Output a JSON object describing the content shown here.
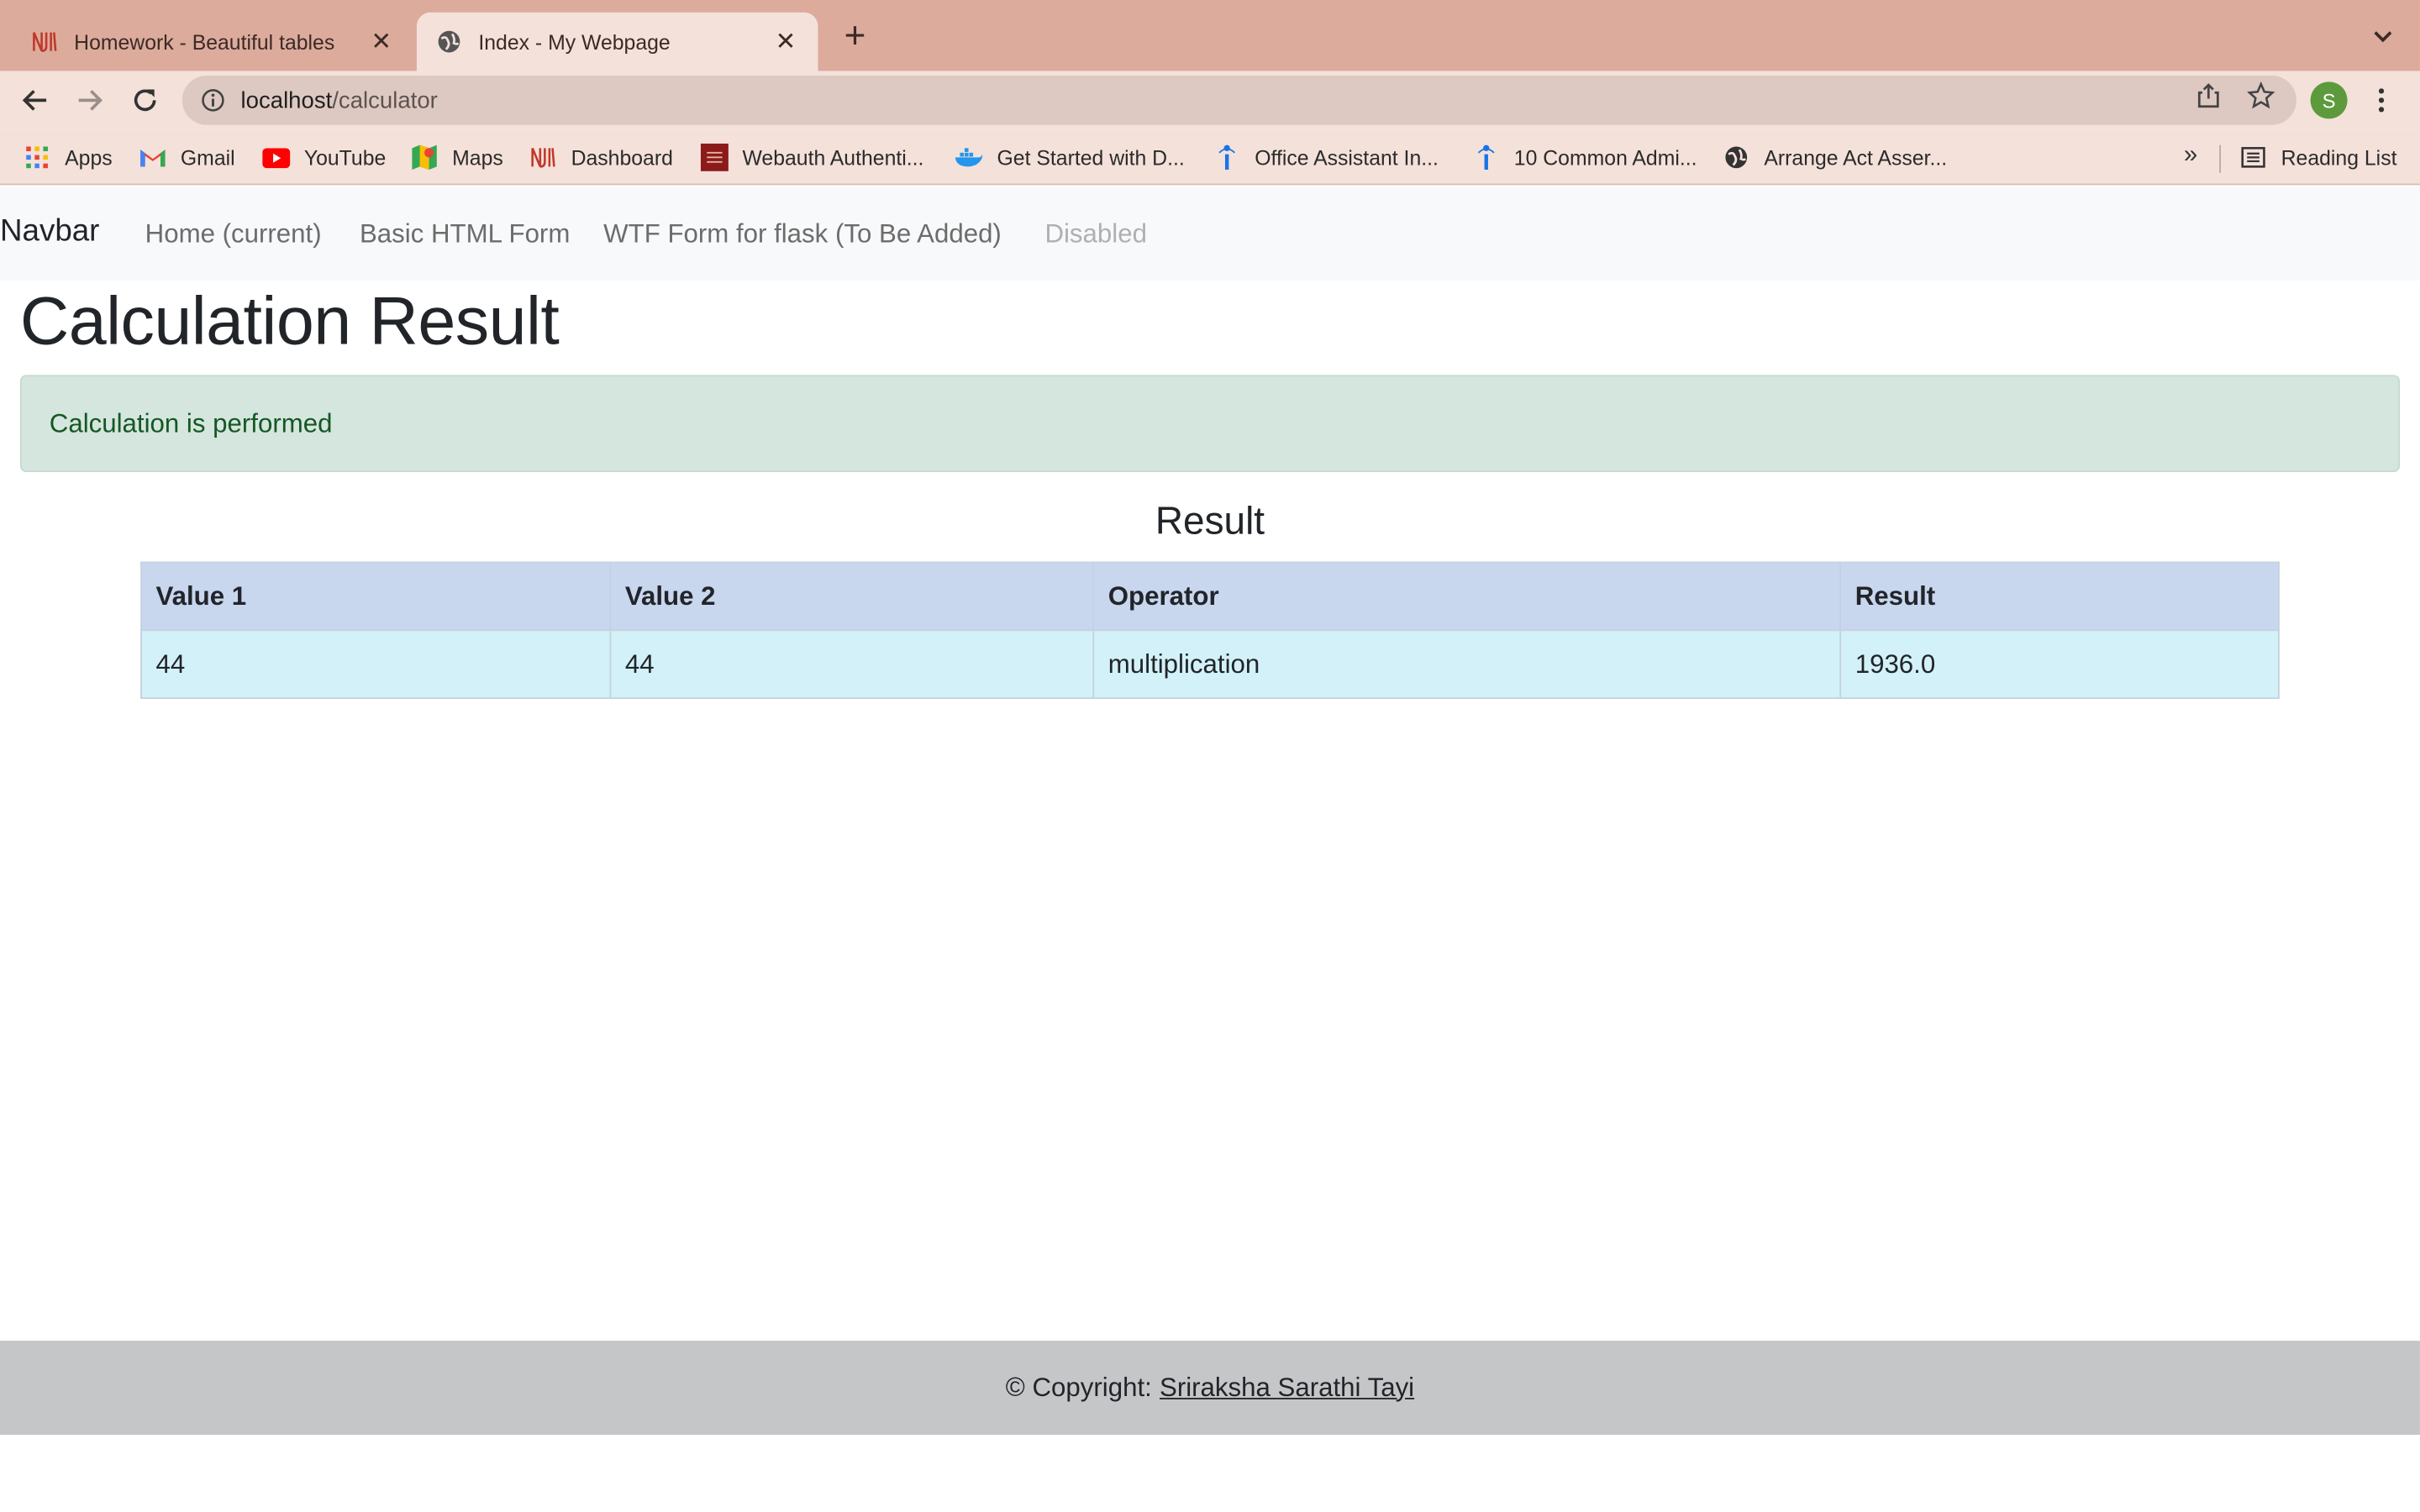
{
  "browser": {
    "tabs": [
      {
        "title": "Homework - Beautiful tables",
        "icon": "njit-logo-icon",
        "active": false
      },
      {
        "title": "Index - My Webpage",
        "icon": "globe-icon",
        "active": true
      }
    ],
    "url_host": "localhost",
    "url_path": "/calculator",
    "profile_initial": "S",
    "bookmarks": [
      {
        "label": "Apps",
        "icon": "apps-grid-icon"
      },
      {
        "label": "Gmail",
        "icon": "gmail-icon"
      },
      {
        "label": "YouTube",
        "icon": "youtube-icon"
      },
      {
        "label": "Maps",
        "icon": "maps-icon"
      },
      {
        "label": "Dashboard",
        "icon": "njit-logo-icon"
      },
      {
        "label": "Webauth Authenti...",
        "icon": "njit-red-icon"
      },
      {
        "label": "Get Started with D...",
        "icon": "docker-icon"
      },
      {
        "label": "Office Assistant In...",
        "icon": "info-person-icon"
      },
      {
        "label": "10 Common Admi...",
        "icon": "info-person-icon"
      },
      {
        "label": "Arrange Act Asser...",
        "icon": "globe-dark-icon"
      }
    ],
    "bookmarks_overflow": "»",
    "reading_list": "Reading List"
  },
  "navbar": {
    "brand": "Navbar",
    "links": [
      {
        "label": "Home (current)",
        "disabled": false
      },
      {
        "label": "Basic HTML Form",
        "disabled": false
      },
      {
        "label": "WTF Form for flask (To Be Added)",
        "disabled": false
      },
      {
        "label": "Disabled",
        "disabled": true
      }
    ]
  },
  "main": {
    "title": "Calculation Result",
    "alert": "Calculation is performed",
    "result_heading": "Result",
    "table": {
      "headers": [
        "Value 1",
        "Value 2",
        "Operator",
        "Result"
      ],
      "rows": [
        [
          "44",
          "44",
          "multiplication",
          "1936.0"
        ]
      ]
    }
  },
  "footer": {
    "prefix": "© Copyright:",
    "author": "Sriraksha Sarathi Tayi"
  },
  "colors": {
    "tabbar_bg": "#dcab9c",
    "toolbar_bg": "#f4e1da",
    "alert_bg": "#d4e6dd",
    "table_header_bg": "#c8d6ee",
    "table_row_bg": "#d3f1f8",
    "footer_bg": "#c5c6c8"
  }
}
